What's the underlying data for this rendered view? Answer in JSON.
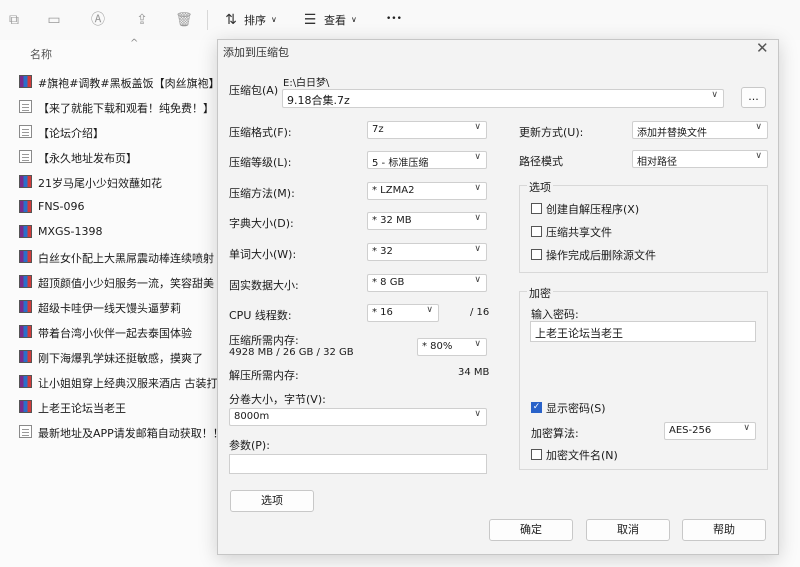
{
  "toolbar": {
    "sort_label": "排序",
    "view_label": "查看",
    "more_label": "•••"
  },
  "file_list": {
    "header_name": "名称",
    "items": [
      {
        "name": "#旗袍#调教#黑板盖饭【肉丝旗袍】",
        "type": "rar"
      },
      {
        "name": "【来了就能下载和观看！纯免费！】",
        "type": "doc"
      },
      {
        "name": "【论坛介绍】",
        "type": "doc"
      },
      {
        "name": "【永久地址发布页】",
        "type": "doc"
      },
      {
        "name": "21岁马尾小少妇效蘸如花",
        "type": "rar"
      },
      {
        "name": "FNS-096",
        "type": "rar"
      },
      {
        "name": "MXGS-1398",
        "type": "rar"
      },
      {
        "name": "白丝女仆配上大黑屌震动棒连续喷射",
        "type": "rar"
      },
      {
        "name": "超顶颜值小少妇服务一流，笑容甜美",
        "type": "rar"
      },
      {
        "name": "超级卡哇伊一线天馒头逼萝莉",
        "type": "rar"
      },
      {
        "name": "带着台湾小伙伴一起去泰国体验",
        "type": "rar"
      },
      {
        "name": "刚下海爆乳学妹还挺敏感，摸爽了",
        "type": "rar"
      },
      {
        "name": "让小姐姐穿上经典汉服来酒店 古装打扮",
        "type": "rar"
      },
      {
        "name": "上老王论坛当老王",
        "type": "rar"
      },
      {
        "name": "最新地址及APP请发邮箱自动获取！！",
        "type": "doc"
      }
    ]
  },
  "dialog": {
    "title": "添加到压缩包",
    "archive_label": "压缩包(A)",
    "archive_path": "E:\\白日梦\\",
    "archive_name": "9.18合集.7z",
    "browse_label": "...",
    "format_label": "压缩格式(F):",
    "format_value": "7z",
    "level_label": "压缩等级(L):",
    "level_value": "5 - 标准压缩",
    "method_label": "压缩方法(M):",
    "method_value": "* LZMA2",
    "dict_label": "字典大小(D):",
    "dict_value": "* 32 MB",
    "word_label": "单词大小(W):",
    "word_value": "* 32",
    "solid_label": "固实数据大小:",
    "solid_value": "* 8 GB",
    "threads_label": "CPU 线程数:",
    "threads_value": "* 16",
    "threads_total": "/ 16",
    "mem_comp_label": "压缩所需内存:",
    "mem_comp_value": "4928 MB / 26 GB / 32 GB",
    "mem_percent": "* 80%",
    "mem_decomp_label": "解压所需内存:",
    "mem_decomp_value": "34 MB",
    "split_label": "分卷大小，字节(V):",
    "split_value": "8000m",
    "params_label": "参数(P):",
    "params_value": "",
    "options_button": "选项",
    "update_label": "更新方式(U):",
    "update_value": "添加并替换文件",
    "path_label": "路径模式",
    "path_value": "相对路径",
    "options_group": "选项",
    "opt_sfx": "创建自解压程序(X)",
    "opt_shared": "压缩共享文件",
    "opt_delete": "操作完成后删除源文件",
    "encrypt_group": "加密",
    "password_label": "输入密码:",
    "password_value": "上老王论坛当老王",
    "show_password": "显示密码(S)",
    "enc_method_label": "加密算法:",
    "enc_method_value": "AES-256",
    "enc_names": "加密文件名(N)",
    "ok": "确定",
    "cancel": "取消",
    "help": "帮助"
  }
}
